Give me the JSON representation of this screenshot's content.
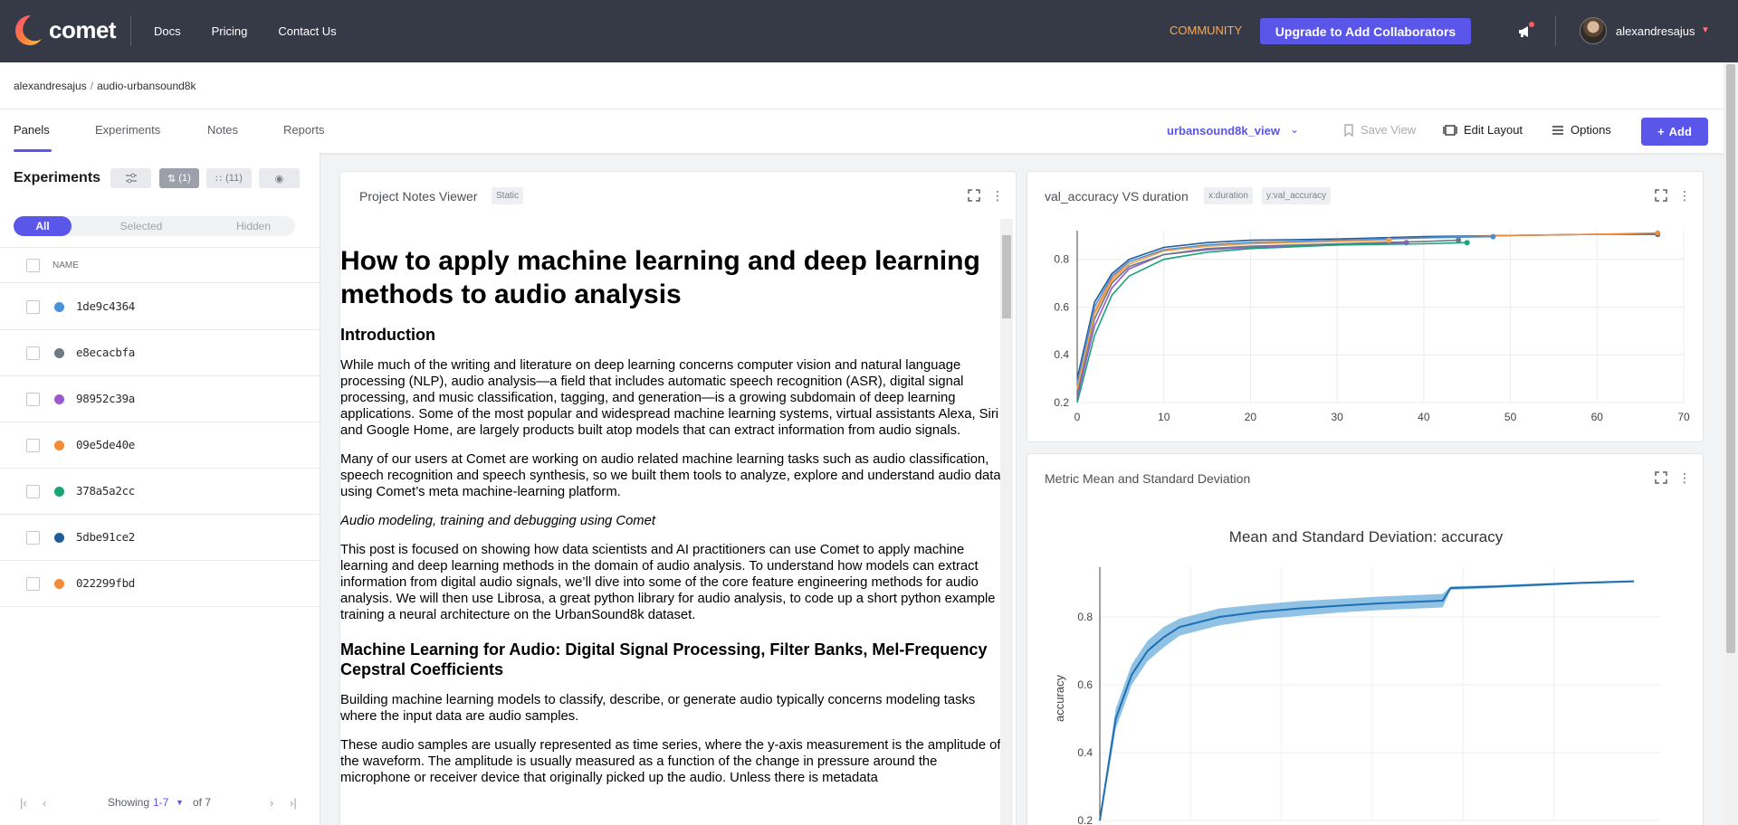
{
  "nav": {
    "logo_text": "comet",
    "links": [
      "Docs",
      "Pricing",
      "Contact Us"
    ],
    "community": "COMMUNITY",
    "upgrade": "Upgrade to Add Collaborators",
    "username": "alexandresajus"
  },
  "breadcrumb": {
    "owner": "alexandresajus",
    "project": "audio-urbansound8k"
  },
  "tabs": [
    "Panels",
    "Experiments",
    "Notes",
    "Reports"
  ],
  "toolbar": {
    "view": "urbansound8k_view",
    "save_view": "Save View",
    "edit_layout": "Edit Layout",
    "options": "Options",
    "add": "Add"
  },
  "experiments_panel": {
    "title": "Experiments",
    "chip_pinned": "(1)",
    "chip_columns": "(11)",
    "segments": [
      "All",
      "Selected",
      "Hidden"
    ],
    "column_name": "NAME",
    "rows": [
      {
        "id": "1de9c4364",
        "color": "#4a90d9"
      },
      {
        "id": "e8ecacbfa",
        "color": "#6c7a86"
      },
      {
        "id": "98952c39a",
        "color": "#9b59d0"
      },
      {
        "id": "09e5de40e",
        "color": "#f28c38"
      },
      {
        "id": "378a5a2cc",
        "color": "#1aa37a"
      },
      {
        "id": "5dbe91ce2",
        "color": "#245b96"
      },
      {
        "id": "022299fbd",
        "color": "#f28c38"
      }
    ],
    "pager": {
      "showing": "Showing",
      "range": "1-7",
      "of": "of 7"
    }
  },
  "notes_card": {
    "title": "Project Notes Viewer",
    "tag": "Static",
    "h1": "How to apply machine learning and deep learning methods to audio analysis",
    "h2_intro": "Introduction",
    "p1": "While much of the writing and literature on deep learning concerns computer vision and natural language processing (NLP), audio analysis—a field that includes automatic speech recognition (ASR), digital signal processing, and music classification, tagging, and generation—is a growing subdomain of deep learning applications. Some of the most popular and widespread machine learning systems, virtual assistants Alexa, Siri and Google Home, are largely products built atop models that can extract information from audio signals.",
    "p2": "Many of our users at Comet are working on audio related machine learning tasks such as audio classification, speech recognition and speech synthesis, so we built them tools to analyze, explore and understand audio data using Comet’s meta machine-learning platform.",
    "p3": "Audio modeling, training and debugging using Comet",
    "p4": "This post is focused on showing how data scientists and AI practitioners can use Comet to apply machine learning and deep learning methods in the domain of audio analysis. To understand how models can extract information from digital audio signals, we’ll dive into some of the core feature engineering methods for audio analysis. We will then use Librosa, a great python library for audio analysis, to code up a short python example training a neural architecture on the UrbanSound8k dataset.",
    "h3": "Machine Learning for Audio: Digital Signal Processing, Filter Banks, Mel-Frequency Cepstral Coefficients",
    "p5": "Building machine learning models to classify, describe, or generate audio typically concerns modeling tasks where the input data are audio samples.",
    "p6": "These audio samples are usually represented as time series, where the y-axis measurement is the amplitude of the waveform. The amplitude is usually measured as a function of the change in pressure around the microphone or receiver device that originally picked up the audio. Unless there is metadata"
  },
  "line_card": {
    "title": "val_accuracy VS duration",
    "tag_x": "x:duration",
    "tag_y": "y:val_accuracy"
  },
  "std_card": {
    "title": "Metric Mean and Standard Deviation"
  },
  "chart_data": [
    {
      "type": "line",
      "xlim": [
        0,
        70
      ],
      "ylim": [
        0.2,
        0.92
      ],
      "x_ticks": [
        0,
        10,
        20,
        30,
        40,
        50,
        60,
        70
      ],
      "y_ticks": [
        0.2,
        0.4,
        0.6,
        0.8
      ],
      "grid": true,
      "series": [
        {
          "color": "#245b96",
          "points": [
            [
              0,
              0.3
            ],
            [
              2,
              0.62
            ],
            [
              4,
              0.74
            ],
            [
              6,
              0.8
            ],
            [
              10,
              0.85
            ],
            [
              15,
              0.87
            ],
            [
              20,
              0.88
            ],
            [
              30,
              0.885
            ],
            [
              40,
              0.895
            ],
            [
              50,
              0.9
            ],
            [
              60,
              0.905
            ],
            [
              67,
              0.905
            ]
          ]
        },
        {
          "color": "#f28c38",
          "points": [
            [
              0,
              0.25
            ],
            [
              2,
              0.58
            ],
            [
              4,
              0.72
            ],
            [
              6,
              0.79
            ],
            [
              10,
              0.84
            ],
            [
              15,
              0.86
            ],
            [
              20,
              0.87
            ],
            [
              30,
              0.88
            ],
            [
              40,
              0.89
            ],
            [
              50,
              0.9
            ],
            [
              60,
              0.905
            ],
            [
              67,
              0.91
            ]
          ]
        },
        {
          "color": "#4a90d9",
          "points": [
            [
              0,
              0.28
            ],
            [
              2,
              0.6
            ],
            [
              4,
              0.73
            ],
            [
              6,
              0.79
            ],
            [
              10,
              0.84
            ],
            [
              15,
              0.86
            ],
            [
              20,
              0.87
            ],
            [
              30,
              0.88
            ],
            [
              40,
              0.89
            ],
            [
              48,
              0.895
            ]
          ]
        },
        {
          "color": "#9b59d0",
          "points": [
            [
              0,
              0.22
            ],
            [
              2,
              0.52
            ],
            [
              4,
              0.68
            ],
            [
              6,
              0.76
            ],
            [
              10,
              0.82
            ],
            [
              15,
              0.84
            ],
            [
              20,
              0.85
            ],
            [
              30,
              0.86
            ],
            [
              38,
              0.87
            ]
          ]
        },
        {
          "color": "#6c7a86",
          "points": [
            [
              0,
              0.24
            ],
            [
              2,
              0.55
            ],
            [
              4,
              0.7
            ],
            [
              6,
              0.77
            ],
            [
              10,
              0.82
            ],
            [
              15,
              0.845
            ],
            [
              20,
              0.855
            ],
            [
              30,
              0.865
            ],
            [
              40,
              0.875
            ],
            [
              44,
              0.88
            ]
          ]
        },
        {
          "color": "#1aa37a",
          "points": [
            [
              0,
              0.2
            ],
            [
              2,
              0.48
            ],
            [
              4,
              0.65
            ],
            [
              6,
              0.73
            ],
            [
              10,
              0.8
            ],
            [
              15,
              0.83
            ],
            [
              20,
              0.845
            ],
            [
              30,
              0.86
            ],
            [
              40,
              0.865
            ],
            [
              45,
              0.87
            ]
          ]
        },
        {
          "color": "#f5a04a",
          "points": [
            [
              0,
              0.26
            ],
            [
              2,
              0.57
            ],
            [
              4,
              0.71
            ],
            [
              6,
              0.78
            ],
            [
              10,
              0.835
            ],
            [
              15,
              0.855
            ],
            [
              20,
              0.865
            ],
            [
              30,
              0.875
            ],
            [
              36,
              0.88
            ]
          ]
        }
      ]
    },
    {
      "type": "line",
      "title": "Mean and Standard Deviation: accuracy",
      "ylabel": "accuracy",
      "ylim": [
        0.2,
        0.92
      ],
      "xlim": [
        0,
        67
      ],
      "y_ticks": [
        0.2,
        0.4,
        0.6,
        0.8
      ],
      "grid": true,
      "series": [
        {
          "name": "mean",
          "color": "#1f6fb2",
          "band_color": "#6aaedb",
          "points": [
            [
              0,
              0.2
            ],
            [
              2,
              0.5
            ],
            [
              4,
              0.63
            ],
            [
              6,
              0.7
            ],
            [
              8,
              0.74
            ],
            [
              10,
              0.77
            ],
            [
              15,
              0.8
            ],
            [
              20,
              0.815
            ],
            [
              25,
              0.825
            ],
            [
              30,
              0.833
            ],
            [
              35,
              0.84
            ],
            [
              40,
              0.845
            ],
            [
              43,
              0.848
            ],
            [
              44,
              0.885
            ],
            [
              50,
              0.89
            ],
            [
              55,
              0.895
            ],
            [
              60,
              0.9
            ],
            [
              67,
              0.905
            ]
          ],
          "std": [
            0.01,
            0.03,
            0.03,
            0.03,
            0.03,
            0.025,
            0.025,
            0.022,
            0.022,
            0.02,
            0.02,
            0.02,
            0.02,
            0.005,
            0.004,
            0.004,
            0.003,
            0.003
          ]
        }
      ]
    }
  ]
}
